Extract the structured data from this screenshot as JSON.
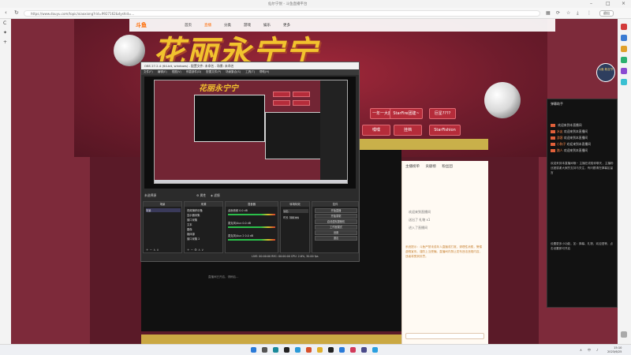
{
  "browser": {
    "tab_title": "仙尔宁悦 - 斗鱼直播平台",
    "url": "https://www.douyu.com/topic/xiaoxiong?rid=9927162&dyshid=…",
    "exit_label": "退出"
  },
  "site": {
    "logo": "斗鱼",
    "nav": [
      "首页",
      "直播",
      "分类",
      "游戏",
      "娱乐",
      "更多"
    ],
    "banner_title": "花丽永宁宁",
    "banner_sub": "宝箱",
    "chips": [
      "一年一大魔王",
      "StarFire团建~",
      "巨星????",
      "StarFishion",
      "挂档",
      "嘿嘿"
    ],
    "video_caption": "直播间已开启，请稍后…"
  },
  "room_panel": {
    "tabs": [
      "主播榜单",
      "贡献榜",
      "粉丝团"
    ],
    "messages": [
      "欢迎来到直播间",
      "送出了 礼物 x1",
      "进入了直播间"
    ],
    "notice": "系统提示：斗鱼严禁未成年人直播或打赏，请理性消费，警惕虚假宣传，谨防上当受骗。直播间内禁止发布违法违规内容，违者将受到处罚。"
  },
  "chat": {
    "header": "弹幕助手",
    "lines": [
      {
        "user": "",
        "text": "欢迎来到本直播间"
      },
      {
        "user": "水友",
        "text": "欢迎来到本直播间"
      },
      {
        "user": "游客",
        "text": "欢迎来到本直播间"
      },
      {
        "user": "小狗子",
        "text": "欢迎来到本直播间"
      },
      {
        "user": "路人",
        "text": "欢迎来到本直播间"
      }
    ],
    "para1": "欢迎来到本直播间哦~ 主播在线陪你聊天，主播粉丝团感谢大家的支持与关注，有问题请在弹幕区留言",
    "para2": "设置更多小功能，如：弹幕、礼物、欢迎语等，点击设置即可开启"
  },
  "avatar_label": "斗鱼 粉丝节",
  "obs": {
    "title": "OBS 27.2.4 (64-bit, windows) - 配置文件: 未命名 - 场景: 未命名",
    "menu": [
      "文件(F)",
      "编辑(E)",
      "视图(V)",
      "停靠部件(D)",
      "配置文件(P)",
      "场景集合(S)",
      "工具(T)",
      "帮助(H)"
    ],
    "preview_title": "花丽永宁宁",
    "source_label": "未选择源",
    "props_label": "属性",
    "filters_label": "滤镜",
    "docks": {
      "scenes": {
        "title": "场景",
        "rows": [
          "场景"
        ]
      },
      "sources": {
        "title": "来源",
        "rows": [
          "视频捕获设备",
          "显示器采集",
          "窗口采集",
          "文本",
          "图像",
          "媒体源",
          "窗口采集 2"
        ]
      },
      "mixer": {
        "title": "混音器",
        "channels": [
          "桌面音频",
          "麦克风/Aux",
          "麦克风/Aux 2"
        ],
        "level": "0.0 dB"
      },
      "transitions": {
        "title": "转场特效",
        "mode": "淡出",
        "duration_label": "时长",
        "duration": "300 ms"
      },
      "controls": {
        "title": "控件",
        "buttons": [
          "开始直播",
          "开始录制",
          "启动虚拟摄像机",
          "工作室模式",
          "设置",
          "退出"
        ]
      }
    },
    "status": "LIVE: 00:00:00   REC: 00:00:00   CPU: 2.6%, 30.00 fps"
  },
  "taskbar": {
    "time": "15:10",
    "date": "2023/6/25",
    "ime": "中"
  }
}
